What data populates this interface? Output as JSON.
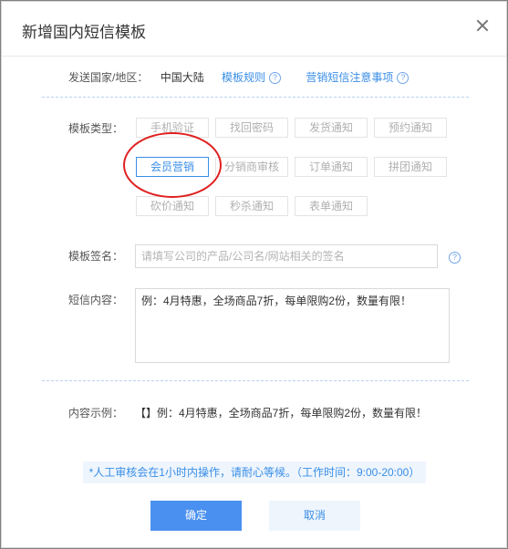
{
  "dialog": {
    "title": "新增国内短信模板",
    "close_icon": "close-icon"
  },
  "country": {
    "label": "发送国家/地区：",
    "value": "中国大陆",
    "rules_link": "模板规则",
    "notes_link": "营销短信注意事项"
  },
  "template_type": {
    "label": "模板类型：",
    "options": [
      "手机验证",
      "找回密码",
      "发货通知",
      "预约通知",
      "会员营销",
      "分销商审核",
      "订单通知",
      "拼团通知",
      "砍价通知",
      "秒杀通知",
      "表单通知"
    ],
    "selected": "会员营销"
  },
  "signature": {
    "label": "模板签名：",
    "placeholder": "请填写公司的产品/公司名/网站相关的签名",
    "value": ""
  },
  "content": {
    "label": "短信内容：",
    "value": "例：4月特惠，全场商品7折，每单限购2份，数量有限！"
  },
  "example": {
    "label": "内容示例：",
    "text": "【】例：4月特惠，全场商品7折，每单限购2份，数量有限！"
  },
  "notice": "*人工审核会在1小时内操作，请耐心等候。（工作时间：9:00-20:00）",
  "buttons": {
    "confirm": "确定",
    "cancel": "取消"
  },
  "colors": {
    "accent": "#3a8ee6",
    "primary_button": "#4a90f0",
    "highlight_circle": "#e02020"
  }
}
